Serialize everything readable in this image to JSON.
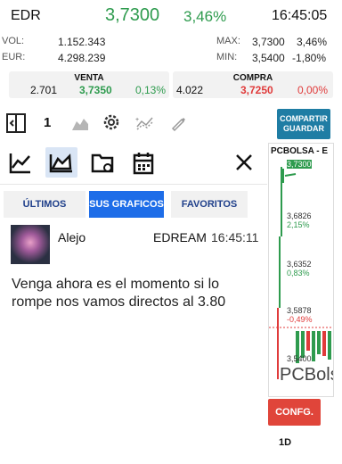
{
  "header": {
    "symbol": "EDR",
    "price": "3,7300",
    "change_pct": "3,46%",
    "time": "16:45:05"
  },
  "stats": {
    "vol_label": "VOL:",
    "vol_value": "1.152.343",
    "eur_label": "EUR:",
    "eur_value": "4.298.239",
    "max_label": "MAX:",
    "max_value": "3,7300",
    "max_pct": "3,46%",
    "min_label": "MIN:",
    "min_value": "3,5400",
    "min_pct": "-1,80%"
  },
  "venta": {
    "title": "VENTA",
    "qty": "2.701",
    "price": "3,7350",
    "pct": "0,13%"
  },
  "compra": {
    "title": "COMPRA",
    "qty": "4.022",
    "price": "3,7250",
    "pct": "0,00%"
  },
  "toolbar": {
    "count": "1",
    "share_line1": "COMPARTIR",
    "share_line2": "GUARDAR"
  },
  "tabs": [
    {
      "label": "ÚLTIMOS",
      "active": false
    },
    {
      "label": "SUS GRAFICOS",
      "active": true
    },
    {
      "label": "FAVORITOS",
      "active": false
    }
  ],
  "post": {
    "author": "Alejo",
    "ticker": "EDREAMS",
    "time": "16:45:11",
    "body": "Venga ahora es el momento si lo rompe nos vamos directos al 3.80"
  },
  "chart": {
    "title": "PCBOLSA - E",
    "levels": [
      {
        "price": "3,7300"
      },
      {
        "price": "3,6826",
        "pct": "2,15%"
      },
      {
        "price": "3,6352",
        "pct": "0,83%"
      },
      {
        "price": "3,5878",
        "pct": "-0,49%"
      },
      {
        "price": "3,5400"
      }
    ],
    "watermark": "PCBolsa",
    "colors": {
      "up": "#2e9b4e",
      "down": "#e03b3b"
    }
  },
  "config_label": "CONFG.",
  "period_label": "1D"
}
